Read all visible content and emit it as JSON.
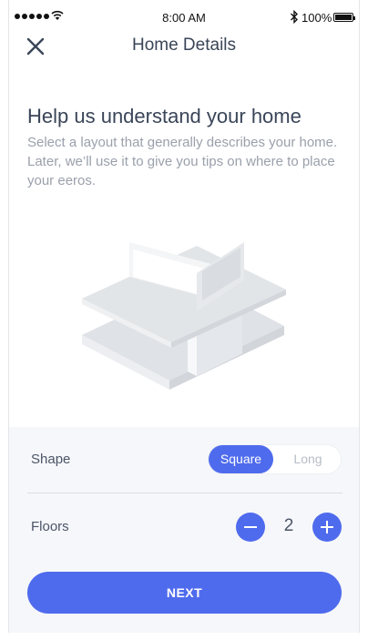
{
  "status_bar": {
    "time": "8:00 AM",
    "battery": "100%"
  },
  "header": {
    "title": "Home Details"
  },
  "content": {
    "heading": "Help us understand your home",
    "description": "Select a layout that generally describes your home. Later, we’ll use it to give you tips on where to place your eeros."
  },
  "shape": {
    "label": "Shape",
    "options": [
      "Square",
      "Long"
    ],
    "selected": "Square"
  },
  "floors": {
    "label": "Floors",
    "count": "2"
  },
  "next_button": {
    "label": "NEXT"
  },
  "colors": {
    "accent": "#4f6bed",
    "panel": "#f5f7fa",
    "text": "#3a4558",
    "muted": "#9aa0ab"
  }
}
